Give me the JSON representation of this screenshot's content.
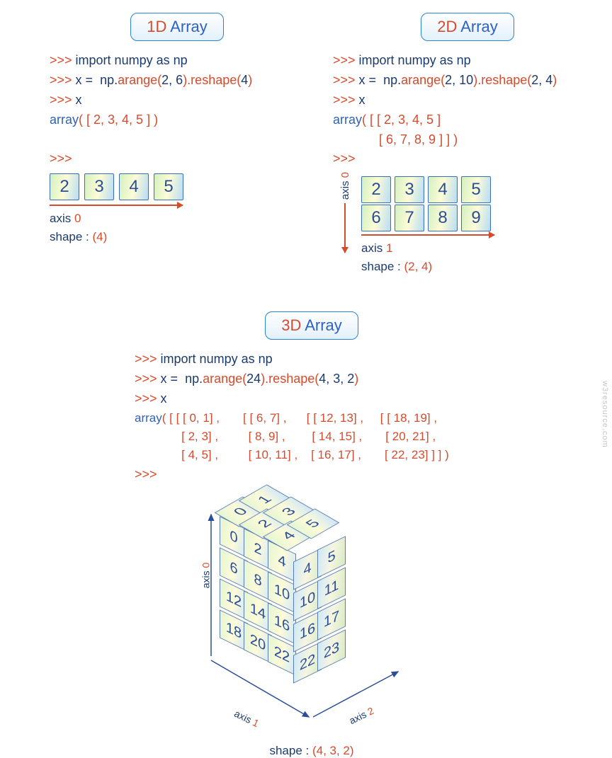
{
  "sections": {
    "d1": {
      "title_prefix": "1D",
      "title_suffix": "Array",
      "code": [
        ">>> import numpy as np",
        ">>> x =  np.arange(2, 6).reshape(4)",
        ">>> x",
        "array( [ 2, 3, 4, 5 ] )",
        "",
        ">>>"
      ],
      "cells": [
        "2",
        "3",
        "4",
        "5"
      ],
      "axis_h": "axis 0",
      "shape_label": "shape :",
      "shape_value": "(4)"
    },
    "d2": {
      "title_prefix": "2D",
      "title_suffix": "Array",
      "code": [
        ">>> import numpy as np",
        ">>> x =  np.arange(2, 10).reshape(2, 4)",
        ">>> x",
        "array( [ [ 2, 3, 4, 5 ]",
        "             [ 6, 7, 8, 9 ] ] )",
        ">>>"
      ],
      "cells": [
        [
          "2",
          "3",
          "4",
          "5"
        ],
        [
          "6",
          "7",
          "8",
          "9"
        ]
      ],
      "axis_v": "axis 0",
      "axis_h": "axis 1",
      "shape_label": "shape :",
      "shape_value": "(2, 4)"
    },
    "d3": {
      "title_prefix": "3D",
      "title_suffix": "Array",
      "code_lines": [
        ">>> import numpy as np",
        ">>> x =  np.arange(24).reshape(4, 3, 2)",
        ">>> x"
      ],
      "array_text": "array( [ [ [ 0, 1] ,       [ [ 6, 7] ,      [ [ 12, 13] ,     [ [ 18, 19] ,\n              [ 2, 3] ,         [ 8, 9] ,        [ 14, 15] ,       [ 20, 21] ,\n              [ 4, 5] ,         [ 10, 11] ,    [ 16, 17] ,       [ 22, 23] ] ] )",
      "prompt_after": ">>>",
      "front": [
        [
          "0",
          "1"
        ],
        [
          "2",
          "3"
        ],
        [
          "4",
          "5"
        ],
        [
          "6",
          "7"
        ],
        [
          "8",
          "9"
        ],
        [
          "10",
          "11"
        ],
        [
          "12",
          "13"
        ],
        [
          "14",
          "15"
        ],
        [
          "16",
          "17"
        ],
        [
          "18",
          "19"
        ],
        [
          "20",
          "21"
        ],
        [
          "22",
          "23"
        ]
      ],
      "front_face": [
        [
          "0",
          "2",
          "4"
        ],
        [
          "6",
          "8",
          "10"
        ],
        [
          "12",
          "14",
          "16"
        ],
        [
          "18",
          "20",
          "22"
        ]
      ],
      "right_face": [
        [
          "5",
          "5"
        ],
        [
          "11",
          "11"
        ],
        [
          "17",
          "17"
        ],
        [
          "23",
          "23"
        ]
      ],
      "right_visible": [
        [
          "4",
          "5"
        ],
        [
          "10",
          "11"
        ],
        [
          "16",
          "17"
        ],
        [
          "22",
          "23"
        ]
      ],
      "top_visible": [
        [
          "0",
          "1"
        ],
        [
          "2",
          "3"
        ],
        [
          "4",
          "5"
        ]
      ],
      "axis0": "axis 0",
      "axis1": "axis 1",
      "axis2": "axis 2",
      "shape_label": "shape :",
      "shape_value": "(4, 3, 2)"
    }
  },
  "chart_data": {
    "type": "table",
    "title": "NumPy 1D / 2D / 3D array examples",
    "arrays": {
      "1D": {
        "shape": [
          4
        ],
        "data": [
          2,
          3,
          4,
          5
        ]
      },
      "2D": {
        "shape": [
          2,
          4
        ],
        "data": [
          [
            2,
            3,
            4,
            5
          ],
          [
            6,
            7,
            8,
            9
          ]
        ]
      },
      "3D": {
        "shape": [
          4,
          3,
          2
        ],
        "data": [
          [
            [
              0,
              1
            ],
            [
              2,
              3
            ],
            [
              4,
              5
            ]
          ],
          [
            [
              6,
              7
            ],
            [
              8,
              9
            ],
            [
              10,
              11
            ]
          ],
          [
            [
              12,
              13
            ],
            [
              14,
              15
            ],
            [
              16,
              17
            ]
          ],
          [
            [
              18,
              19
            ],
            [
              20,
              21
            ],
            [
              22,
              23
            ]
          ]
        ]
      }
    }
  },
  "watermark": "w3resource.com"
}
